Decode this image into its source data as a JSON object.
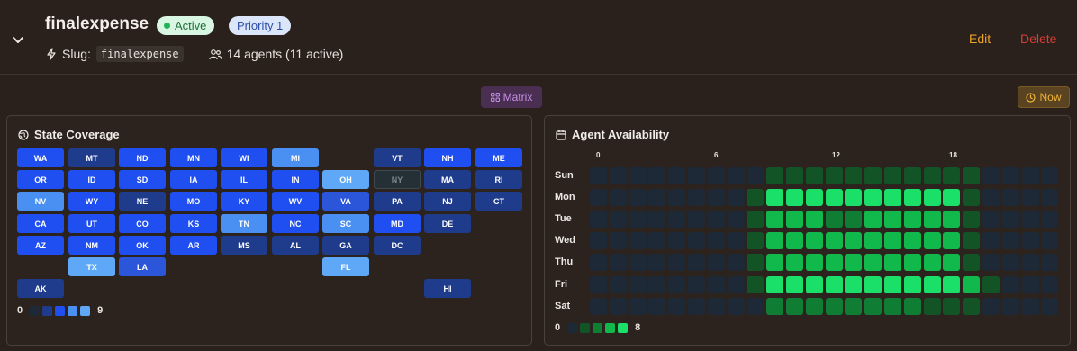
{
  "header": {
    "title": "finalexpense",
    "status_badge": "Active",
    "priority_badge": "Priority 1",
    "slug_label": "Slug:",
    "slug_value": "finalexpense",
    "agents_text": "14 agents (11 active)",
    "edit_label": "Edit",
    "delete_label": "Delete"
  },
  "toolbar": {
    "matrix_label": "Matrix",
    "now_label": "Now"
  },
  "colors": {
    "accent_edit": "#eba12a",
    "accent_delete": "#d63e36",
    "coverage_scale": [
      "#1f3b8c",
      "#2b56d9",
      "#1f4ff0",
      "#4a90f2",
      "#5fa8f7"
    ],
    "availability_scale": [
      "#1d2936",
      "#135427",
      "#0f7d34",
      "#11b84c",
      "#1ae06a"
    ]
  },
  "coverage": {
    "title": "State Coverage",
    "legend_min": "0",
    "legend_max": "9",
    "rows": [
      [
        {
          "s": "WA",
          "c": 1
        },
        {
          "s": "MT",
          "c": 0
        },
        {
          "s": "ND",
          "c": 1
        },
        {
          "s": "MN",
          "c": 1
        },
        {
          "s": "WI",
          "c": 1
        },
        {
          "s": "MI",
          "c": 3
        },
        null,
        {
          "s": "VT",
          "c": 0
        },
        {
          "s": "NH",
          "c": 1
        },
        {
          "s": "ME",
          "c": 1
        }
      ],
      [
        {
          "s": "OR",
          "c": 1
        },
        {
          "s": "ID",
          "c": 1
        },
        {
          "s": "SD",
          "c": 1
        },
        {
          "s": "IA",
          "c": 1
        },
        {
          "s": "IL",
          "c": 1
        },
        {
          "s": "IN",
          "c": 1
        },
        {
          "s": "OH",
          "c": 4
        },
        {
          "s": "NY",
          "c": -1
        },
        {
          "s": "MA",
          "c": 0
        },
        {
          "s": "RI",
          "c": 0
        }
      ],
      [
        {
          "s": "NV",
          "c": 3
        },
        {
          "s": "WY",
          "c": 1
        },
        {
          "s": "NE",
          "c": 0
        },
        {
          "s": "MO",
          "c": 1
        },
        {
          "s": "KY",
          "c": 1
        },
        {
          "s": "WV",
          "c": 1
        },
        {
          "s": "VA",
          "c": 2
        },
        {
          "s": "PA",
          "c": 0
        },
        {
          "s": "NJ",
          "c": 0
        },
        {
          "s": "CT",
          "c": 0
        }
      ],
      [
        {
          "s": "CA",
          "c": 1
        },
        {
          "s": "UT",
          "c": 1
        },
        {
          "s": "CO",
          "c": 1
        },
        {
          "s": "KS",
          "c": 1
        },
        {
          "s": "TN",
          "c": 3
        },
        {
          "s": "NC",
          "c": 1
        },
        {
          "s": "SC",
          "c": 3
        },
        {
          "s": "MD",
          "c": 1
        },
        {
          "s": "DE",
          "c": 0
        },
        null
      ],
      [
        {
          "s": "AZ",
          "c": 1
        },
        {
          "s": "NM",
          "c": 1
        },
        {
          "s": "OK",
          "c": 1
        },
        {
          "s": "AR",
          "c": 1
        },
        {
          "s": "MS",
          "c": 0
        },
        {
          "s": "AL",
          "c": 0
        },
        {
          "s": "GA",
          "c": 0
        },
        {
          "s": "DC",
          "c": 0
        },
        null,
        null
      ],
      [
        null,
        {
          "s": "TX",
          "c": 4
        },
        {
          "s": "LA",
          "c": 2
        },
        null,
        null,
        null,
        {
          "s": "FL",
          "c": 4
        },
        null,
        null,
        null
      ],
      [
        {
          "s": "AK",
          "c": 0
        },
        null,
        null,
        null,
        null,
        null,
        null,
        null,
        {
          "s": "HI",
          "c": 0
        },
        null
      ]
    ]
  },
  "availability": {
    "title": "Agent Availability",
    "hour_labels": [
      {
        "h": 0,
        "t": "0"
      },
      {
        "h": 6,
        "t": "6"
      },
      {
        "h": 12,
        "t": "12"
      },
      {
        "h": 18,
        "t": "18"
      }
    ],
    "legend_min": "0",
    "legend_max": "8",
    "days": [
      {
        "d": "Sun",
        "v": [
          0,
          0,
          0,
          0,
          0,
          0,
          0,
          0,
          0,
          1,
          1,
          1,
          1,
          1,
          1,
          1,
          1,
          1,
          1,
          1,
          0,
          0,
          0,
          0
        ]
      },
      {
        "d": "Mon",
        "v": [
          0,
          0,
          0,
          0,
          0,
          0,
          0,
          0,
          1,
          4,
          4,
          4,
          4,
          4,
          4,
          4,
          4,
          4,
          4,
          1,
          0,
          0,
          0,
          0
        ]
      },
      {
        "d": "Tue",
        "v": [
          0,
          0,
          0,
          0,
          0,
          0,
          0,
          0,
          1,
          3,
          3,
          3,
          2,
          2,
          3,
          3,
          3,
          3,
          3,
          1,
          0,
          0,
          0,
          0
        ]
      },
      {
        "d": "Wed",
        "v": [
          0,
          0,
          0,
          0,
          0,
          0,
          0,
          0,
          1,
          3,
          3,
          3,
          3,
          3,
          3,
          3,
          3,
          3,
          3,
          1,
          0,
          0,
          0,
          0
        ]
      },
      {
        "d": "Thu",
        "v": [
          0,
          0,
          0,
          0,
          0,
          0,
          0,
          0,
          1,
          3,
          3,
          3,
          3,
          3,
          3,
          3,
          3,
          3,
          3,
          1,
          0,
          0,
          0,
          0
        ]
      },
      {
        "d": "Fri",
        "v": [
          0,
          0,
          0,
          0,
          0,
          0,
          0,
          0,
          1,
          4,
          4,
          4,
          4,
          4,
          4,
          4,
          4,
          4,
          4,
          3,
          1,
          0,
          0,
          0
        ]
      },
      {
        "d": "Sat",
        "v": [
          0,
          0,
          0,
          0,
          0,
          0,
          0,
          0,
          0,
          2,
          2,
          2,
          2,
          2,
          2,
          2,
          2,
          1,
          1,
          1,
          0,
          0,
          0,
          0
        ]
      }
    ]
  }
}
